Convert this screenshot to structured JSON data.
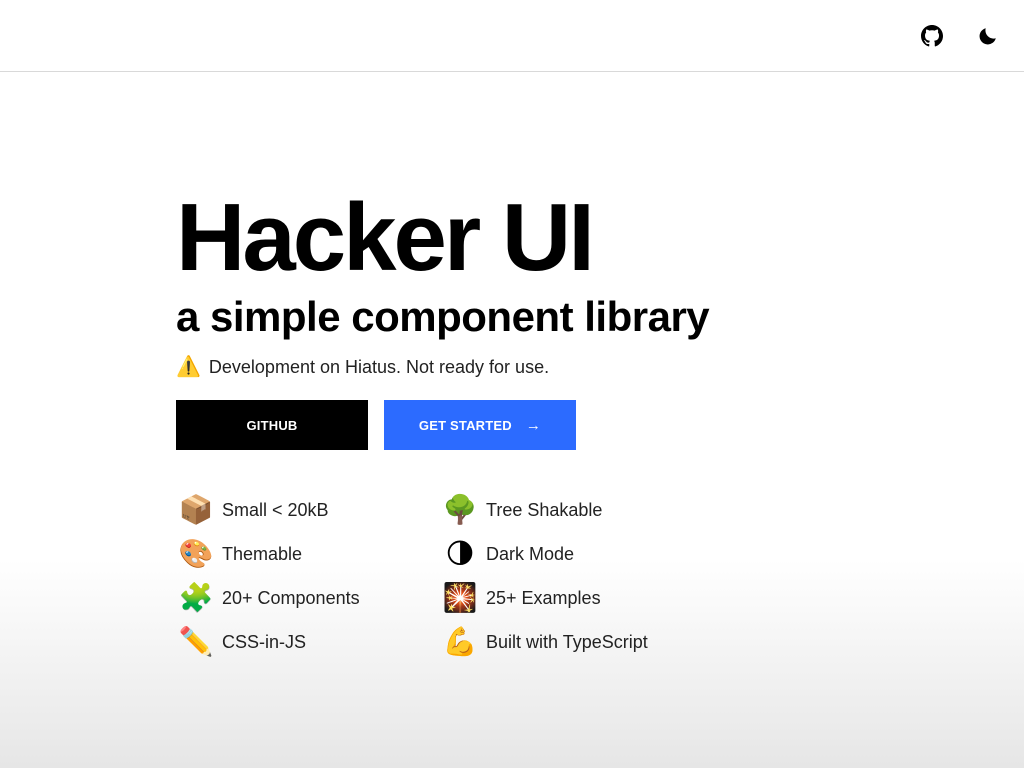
{
  "header": {
    "github_icon": "github-icon",
    "theme_icon": "moon-icon"
  },
  "hero": {
    "title": "Hacker UI",
    "subtitle": "a simple component library",
    "notice_icon": "⚠️",
    "notice": "Development on Hiatus. Not ready for use."
  },
  "buttons": {
    "github_label": "GITHUB",
    "get_started_label": "GET STARTED",
    "arrow": "→"
  },
  "features": [
    {
      "icon": "📦",
      "icon_name": "package-icon",
      "label": "Small < 20kB"
    },
    {
      "icon": "🌳",
      "icon_name": "tree-icon",
      "label": "Tree Shakable"
    },
    {
      "icon": "🎨",
      "icon_name": "palette-icon",
      "label": "Themable"
    },
    {
      "icon": "🌗",
      "icon_name": "half-moon-icon",
      "label": "Dark Mode"
    },
    {
      "icon": "🧩",
      "icon_name": "puzzle-icon",
      "label": "20+ Components"
    },
    {
      "icon": "🎇",
      "icon_name": "sparkler-icon",
      "label": "25+ Examples"
    },
    {
      "icon": "✏️",
      "icon_name": "pencil-icon",
      "label": "CSS-in-JS"
    },
    {
      "icon": "💪",
      "icon_name": "flexed-biceps-icon",
      "label": "Built with TypeScript"
    }
  ],
  "colors": {
    "primary_button": "#000000",
    "accent_button": "#2c6bff"
  }
}
